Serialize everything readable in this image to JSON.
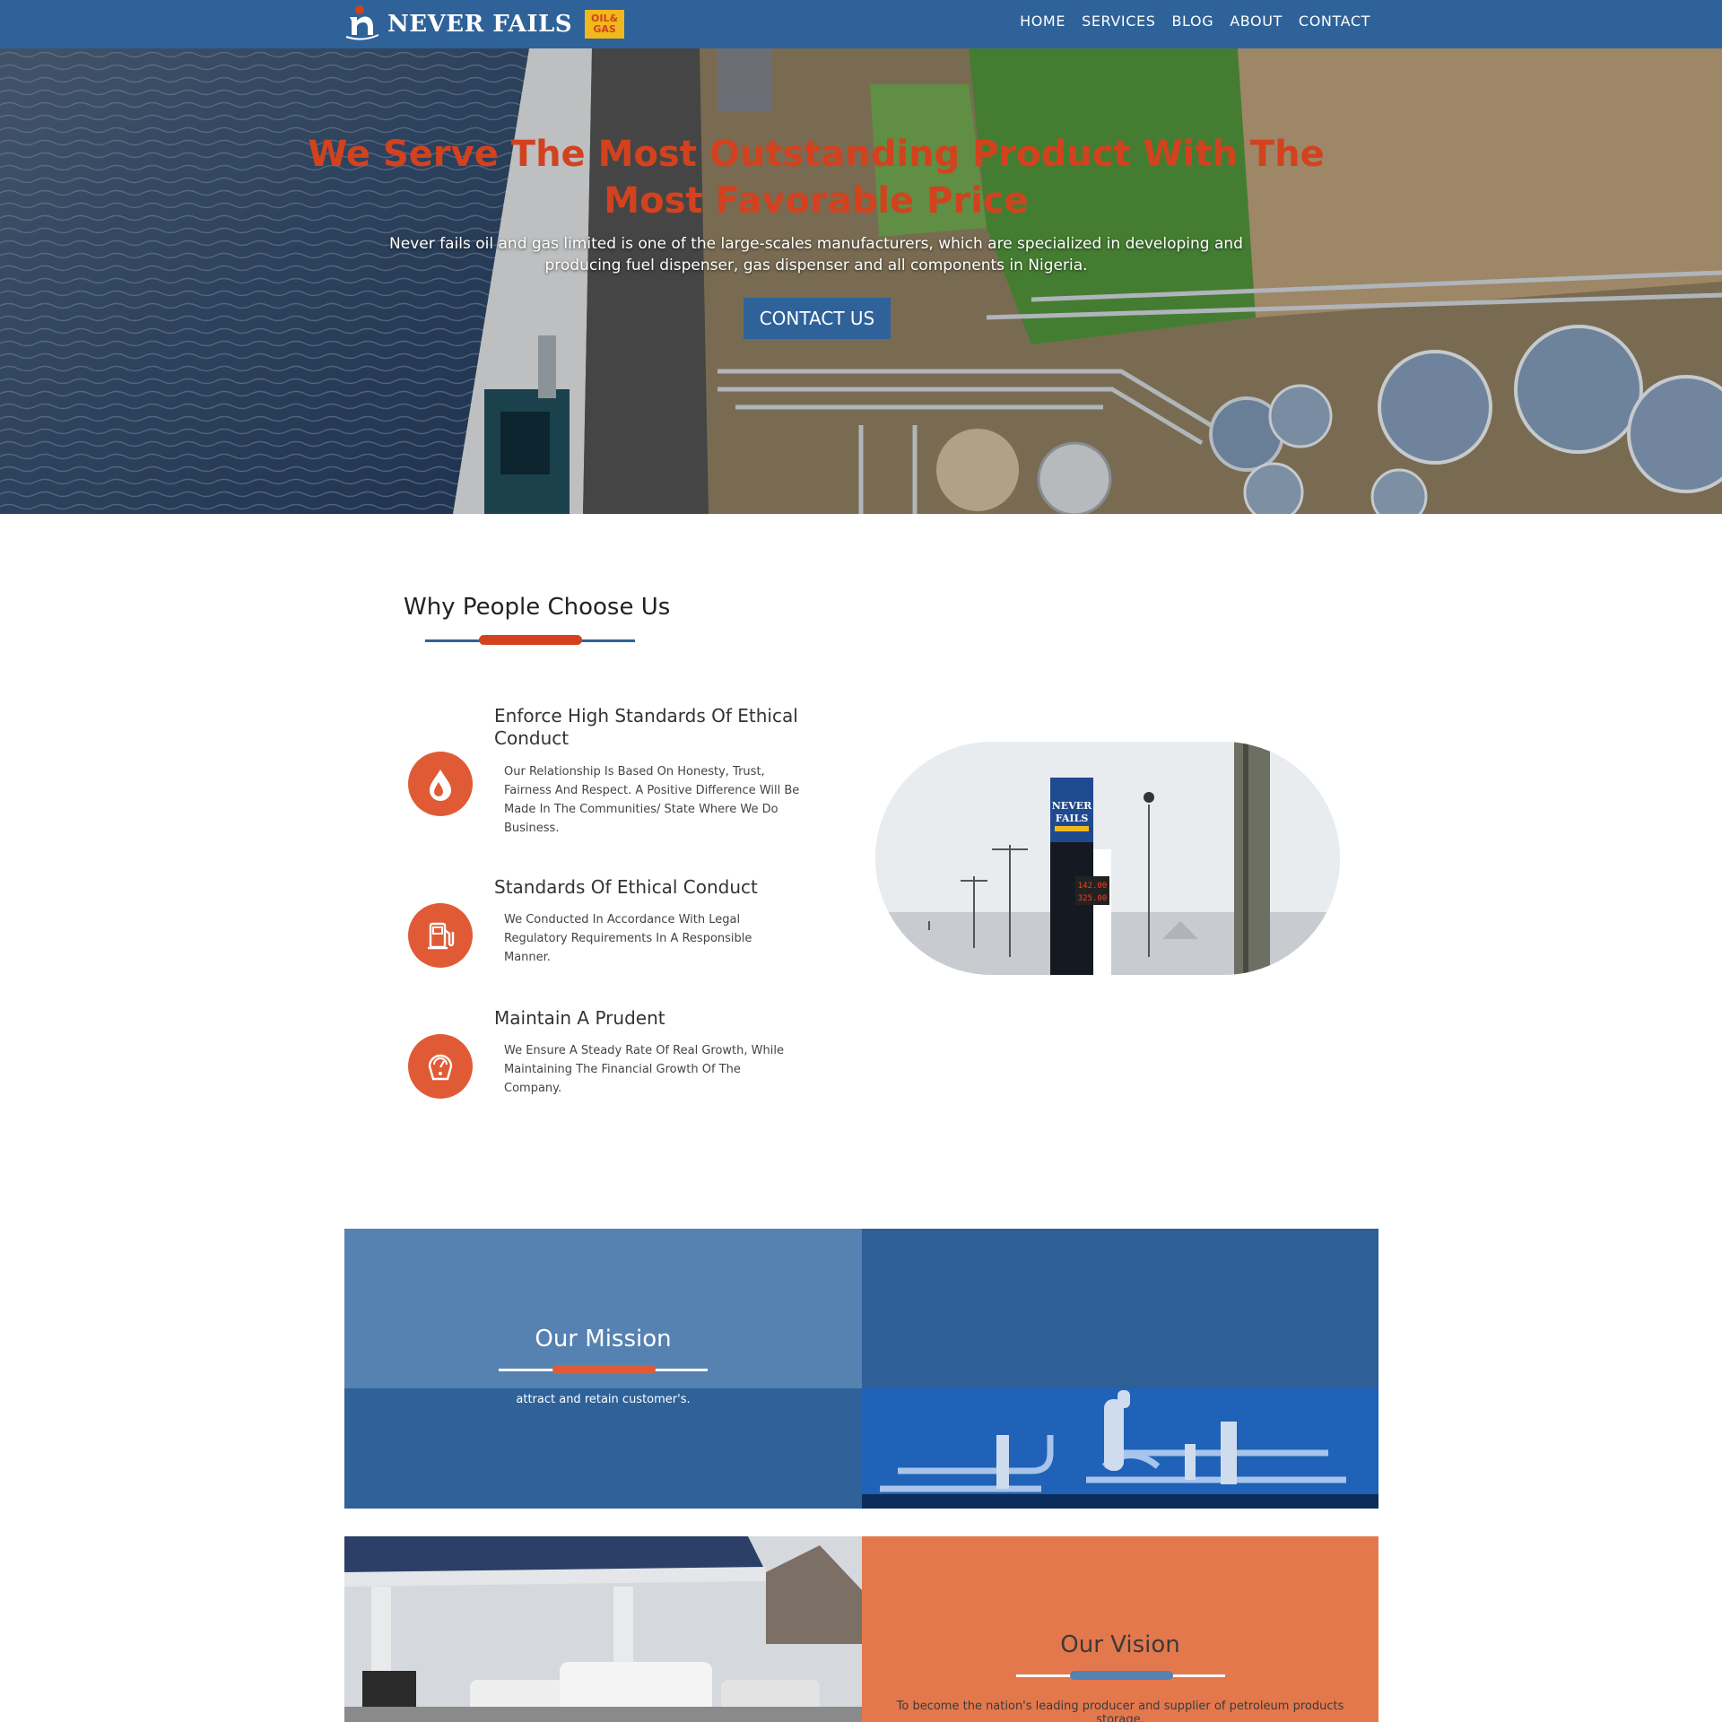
{
  "nav": {
    "brand": "NEVER FAILS",
    "badge_line1": "OIL&",
    "badge_line2": "GAS",
    "items": [
      "HOME",
      "SERVICES",
      "BLOG",
      "ABOUT",
      "CONTACT"
    ]
  },
  "hero": {
    "title": "We Serve The Most Outstanding Product With The Most Favorable Price",
    "subtitle": "Never fails oil and gas limited is one of the large-scales manufacturers, which are specialized in developing and producing fuel dispenser, gas dispenser and all components in Nigeria.",
    "cta_label": "CONTACT US"
  },
  "why": {
    "title": "Why People Choose Us",
    "features": [
      {
        "title": "Enforce High Standards Of Ethical Conduct",
        "text": "Our Relationship Is Based On Honesty, Trust, Fairness And Respect. A Positive Difference Will Be Made In The Communities/ State Where We Do Business.",
        "icon": "oil-drops-icon"
      },
      {
        "title": "Standards Of Ethical Conduct",
        "text": "We Conducted In Accordance With Legal Regulatory Requirements In A Responsible Manner.",
        "icon": "fuel-pump-icon"
      },
      {
        "title": "Maintain A Prudent",
        "text": "We Ensure A Steady Rate Of Real Growth, While Maintaining The Financial Growth Of The Company.",
        "icon": "gauge-icon"
      }
    ],
    "photo_sign_line1": "NEVER",
    "photo_sign_line2": "FAILS",
    "photo_price1": "142.00",
    "photo_price2": "325.00"
  },
  "mission": {
    "title": "Our Mission",
    "text": "attract and retain customer's."
  },
  "vision": {
    "title": "Our Vision",
    "text": "To become the nation's leading producer and supplier of petroleum products storage,"
  },
  "colors": {
    "primary_blue": "#2e6299",
    "light_blue": "#5582b0",
    "accent_orange": "#d3421e",
    "icon_orange": "#e05b35",
    "vision_orange": "#e4784d"
  }
}
